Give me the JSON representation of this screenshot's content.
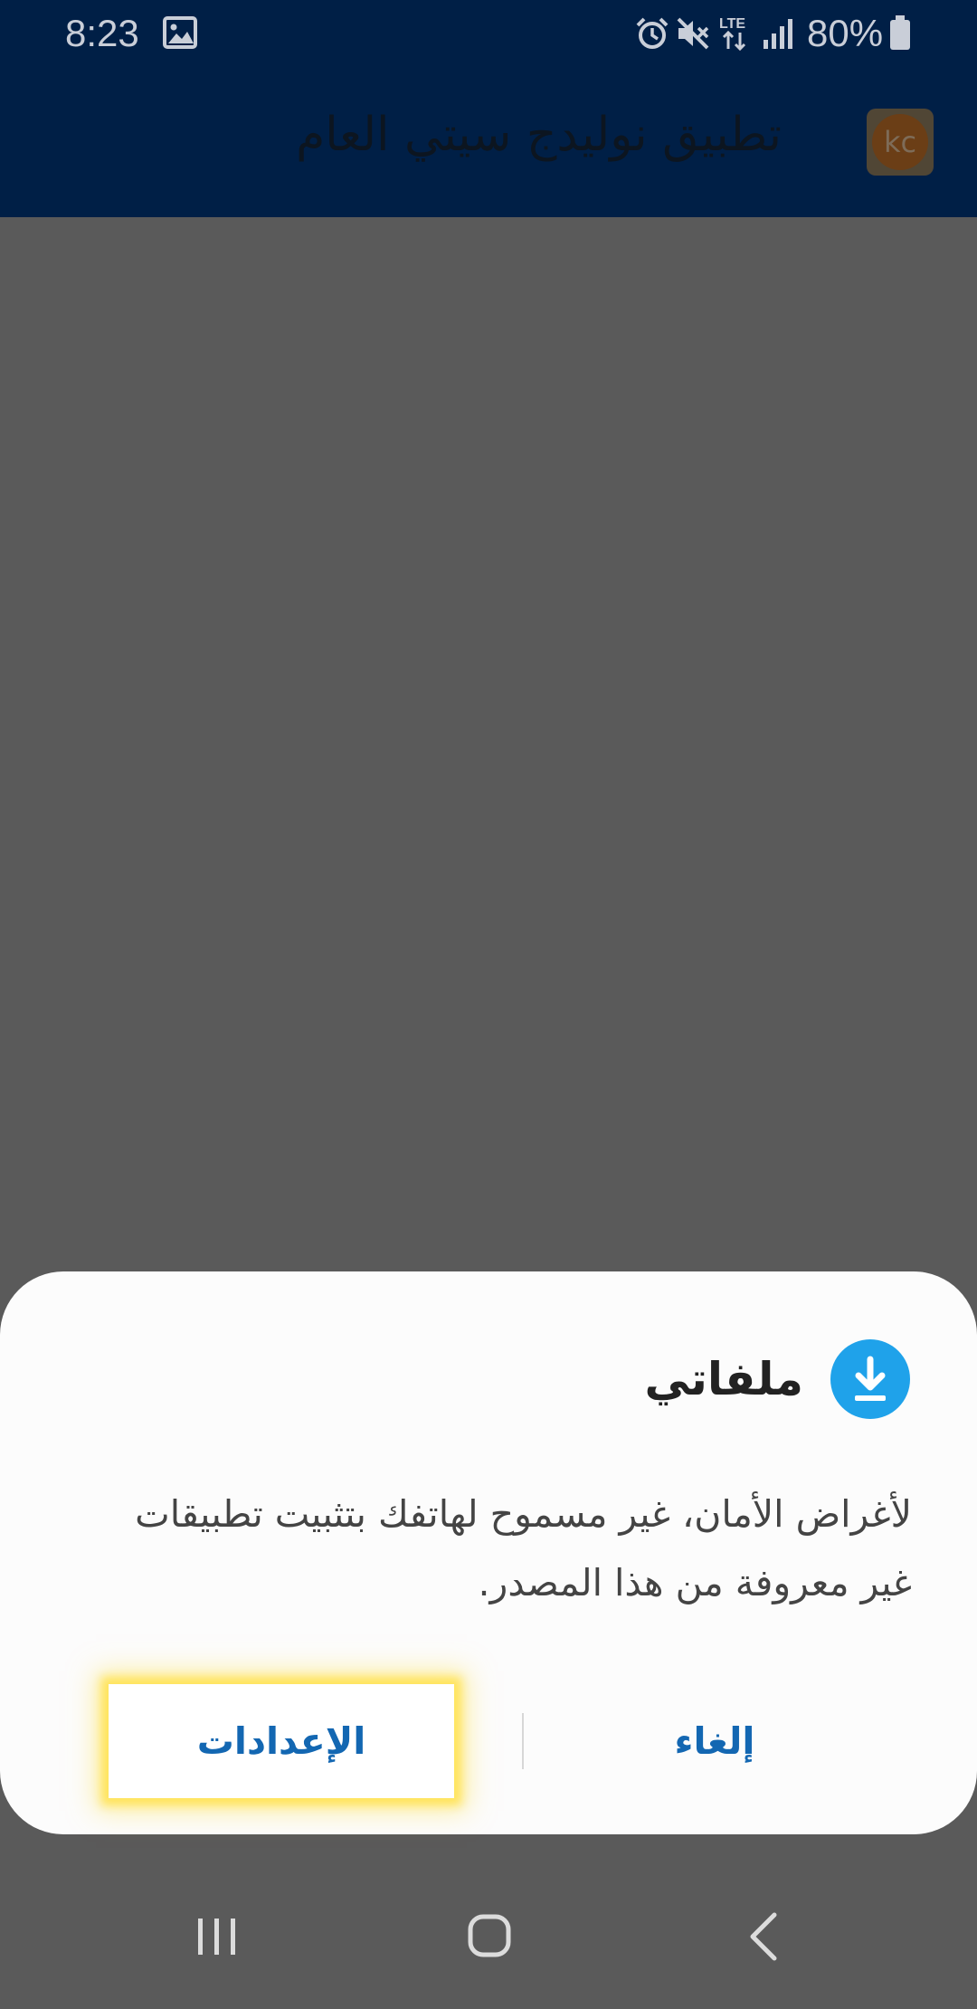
{
  "status_bar": {
    "time": "8:23",
    "battery": "80%",
    "icons": [
      "image-notification-icon",
      "alarm-icon",
      "mute-icon",
      "lte-icon",
      "signal-icon",
      "battery-icon"
    ]
  },
  "app_bar": {
    "title": "تطبيق نوليدج سيتي العام",
    "logo_text": "kc"
  },
  "dialog": {
    "title": "ملفاتي",
    "message": "لأغراض الأمان، غير مسموح لهاتفك بتثبيت تطبيقات غير معروفة من هذا المصدر.",
    "cancel_label": "إلغاء",
    "settings_label": "الإعدادات"
  },
  "nav_bar": {
    "icons": [
      "recent-apps-icon",
      "home-icon",
      "back-icon"
    ]
  },
  "colors": {
    "app_bar_bg": "#001f46",
    "scrim": "#5a5a5a",
    "accent": "#1367b2",
    "download_icon": "#1fa2ea",
    "highlight": "#ffe45c"
  }
}
